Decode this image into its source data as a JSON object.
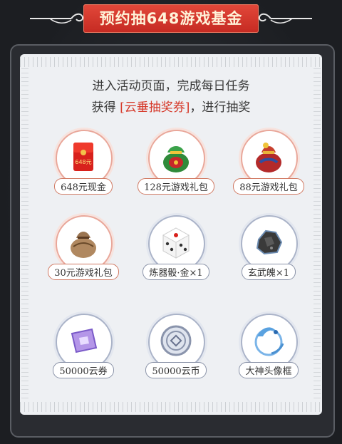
{
  "header": {
    "title": "预约抽648游戏基金"
  },
  "intro": {
    "line1": "进入活动页面，完成每日任务",
    "line2_prefix": "获得 ",
    "line2_highlight": "[云垂抽奖券]",
    "line2_suffix": "，进行抽奖"
  },
  "prizes": [
    {
      "label": "648元现金",
      "icon": "red-envelope-icon"
    },
    {
      "label": "128元游戏礼包",
      "icon": "green-gift-bag-icon"
    },
    {
      "label": "88元游戏礼包",
      "icon": "red-gift-bag-icon"
    },
    {
      "label": "30元游戏礼包",
      "icon": "brown-gift-bag-icon"
    },
    {
      "label": "炼器骰·金×1",
      "icon": "dice-icon"
    },
    {
      "label": "玄武魄×1",
      "icon": "ore-stone-icon"
    },
    {
      "label": "50000云券",
      "icon": "purple-ticket-icon"
    },
    {
      "label": "50000云币",
      "icon": "silver-coin-icon"
    },
    {
      "label": "大神头像框",
      "icon": "avatar-frame-icon"
    }
  ],
  "envelope_text": "648元",
  "colors": {
    "accent_red": "#d63a2b",
    "banner_red": "#c52a22",
    "panel_bg": "#eef0f3",
    "outer_bg": "#1c1e22"
  }
}
